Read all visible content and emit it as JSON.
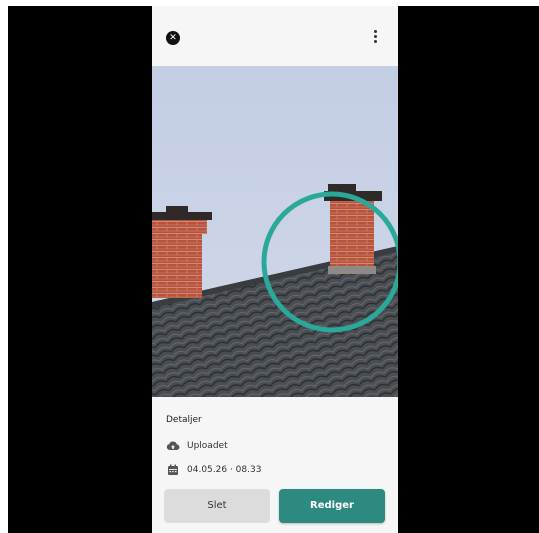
{
  "topbar": {
    "close_icon": "close-icon",
    "menu_icon": "more-vertical-icon"
  },
  "photo": {
    "annotation_color": "#2aa89a",
    "sky_color": "#c9d3e6"
  },
  "details": {
    "title": "Detaljer",
    "upload_icon": "cloud-upload-icon",
    "upload_status": "Uploadet",
    "date_icon": "calendar-icon",
    "date": "04.05.26 · 08.33"
  },
  "actions": {
    "delete_label": "Slet",
    "edit_label": "Rediger",
    "accent_color": "#2c8a80"
  }
}
